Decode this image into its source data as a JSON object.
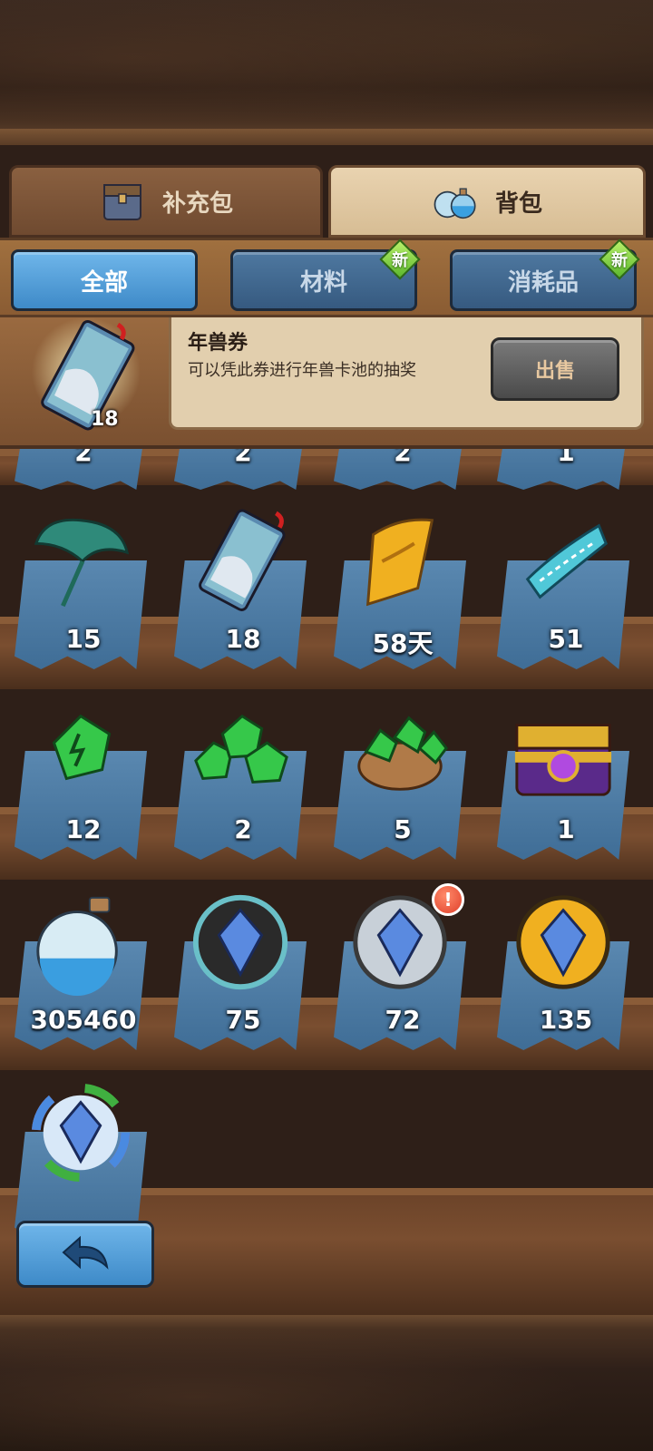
{
  "tabs": [
    {
      "label": "补充包",
      "icon": "chest-icon"
    },
    {
      "label": "背包",
      "icon": "potion-icon"
    }
  ],
  "filters": [
    {
      "label": "全部",
      "active": true,
      "is_new": false
    },
    {
      "label": "材料",
      "active": false,
      "is_new": true
    },
    {
      "label": "消耗品",
      "active": false,
      "is_new": true
    }
  ],
  "new_badge_label": "新",
  "selected_item": {
    "name": "年兽券",
    "description": "可以凭此券进行年兽卡池的抽奖",
    "count": "18",
    "sell_label": "出售",
    "icon": "nian-ticket-icon"
  },
  "partial_row": [
    "2",
    "2",
    "2",
    "1"
  ],
  "items": [
    {
      "icon": "lotus-leaf-icon",
      "count": "15"
    },
    {
      "icon": "nian-ticket-icon",
      "count": "18"
    },
    {
      "icon": "gold-scroll-icon",
      "count": "58天"
    },
    {
      "icon": "blue-ribbon-icon",
      "count": "51"
    },
    {
      "icon": "green-crystal-icon",
      "count": "12"
    },
    {
      "icon": "green-crystal-pile-icon",
      "count": "2"
    },
    {
      "icon": "green-crystal-bag-icon",
      "count": "5"
    },
    {
      "icon": "purple-chest-icon",
      "count": "1"
    },
    {
      "icon": "blue-sand-bottle-icon",
      "count": "305460"
    },
    {
      "icon": "black-gem-orb-icon",
      "count": "75"
    },
    {
      "icon": "silver-gem-orb-icon",
      "count": "72",
      "alert": "!"
    },
    {
      "icon": "gold-gem-orb-icon",
      "count": "135"
    },
    {
      "icon": "rainbow-gem-orb-icon",
      "count": ""
    }
  ],
  "back_icon": "back-arrow-icon"
}
